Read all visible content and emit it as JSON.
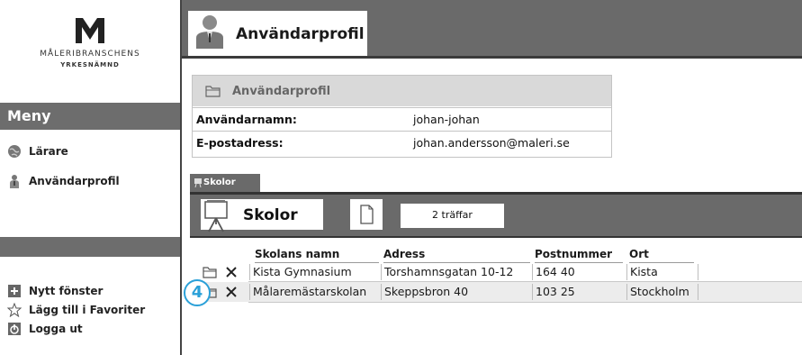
{
  "logo": {
    "line1": "MÅLERIBRANSCHENS",
    "line2": "YRKESNÄMND"
  },
  "sidebar": {
    "menu_title": "Meny",
    "items": [
      {
        "label": "Lärare",
        "icon": "globe-icon"
      },
      {
        "label": "Användarprofil",
        "icon": "person-icon"
      }
    ],
    "bottom_items": [
      {
        "label": "Nytt fönster",
        "icon": "plus-icon"
      },
      {
        "label": "Lägg till i Favoriter",
        "icon": "star-icon"
      },
      {
        "label": "Logga ut",
        "icon": "power-icon"
      }
    ]
  },
  "header": {
    "title": "Användarprofil"
  },
  "profile": {
    "title": "Användarprofil",
    "rows": [
      {
        "label": "Användarnamn:",
        "value": "johan-johan"
      },
      {
        "label": "E-postadress:",
        "value": "johan.andersson@maleri.se"
      }
    ]
  },
  "schools": {
    "tab_label": "Skolor",
    "title": "Skolor",
    "hits": "2 träffar",
    "columns": [
      "Skolans namn",
      "Adress",
      "Postnummer",
      "Ort"
    ],
    "rows": [
      [
        "Kista Gymnasium",
        "Torshamnsgatan 10-12",
        "164 40",
        "Kista"
      ],
      [
        "Målaremästarskolan",
        "Skeppsbron 40",
        "103 25",
        "Stockholm"
      ]
    ]
  },
  "callout": "4",
  "colors": {
    "dark_gray": "#6a6a6a",
    "callout_blue": "#2aa0d8"
  }
}
